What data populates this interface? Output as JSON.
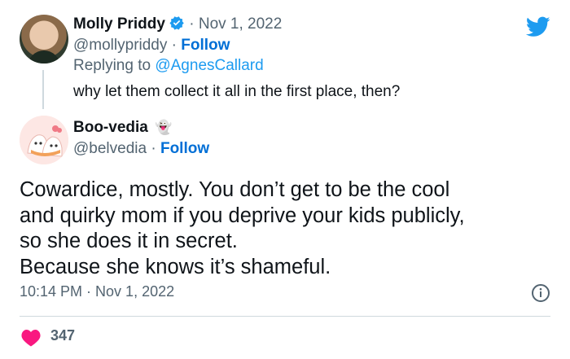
{
  "reply_tweet": {
    "display_name": "Molly Priddy",
    "separator": " · ",
    "date": "Nov 1, 2022",
    "handle": "@mollypriddy",
    "follow_sep": " · ",
    "follow_label": "Follow",
    "replying_prefix": "Replying to ",
    "replying_to": "@AgnesCallard",
    "text": "why let them collect it all in the first place, then?"
  },
  "main_tweet": {
    "display_name": "Boo-vedia",
    "name_emoji": "👻",
    "handle": "@belvedia",
    "follow_sep": " · ",
    "follow_label": "Follow",
    "text": "Cowardice, mostly. You don’t get to be the cool\nand quirky mom if you deprive your kids publicly,\nso she does it in secret.\nBecause she knows it’s shameful.",
    "timestamp": "10:14 PM · Nov 1, 2022",
    "likes": "347"
  },
  "icons": {
    "logo": "twitter-bird-icon",
    "verified": "verified-badge-icon",
    "info": "info-icon",
    "like": "heart-icon"
  },
  "colors": {
    "brand": "#1d9bf0",
    "follow": "#006fd6",
    "muted": "#536471",
    "heart": "#f91880"
  }
}
